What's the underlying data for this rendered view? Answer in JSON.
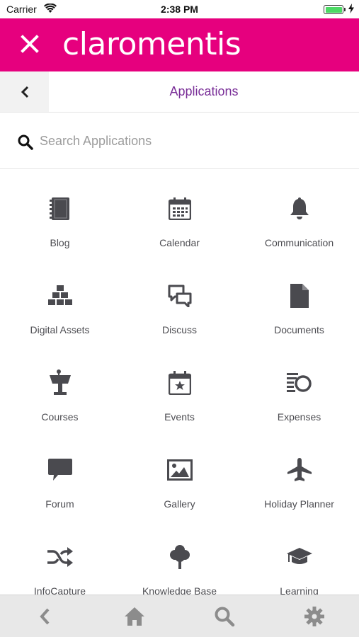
{
  "status_bar": {
    "carrier": "Carrier",
    "time": "2:38 PM",
    "battery_level": 1.0
  },
  "brand": {
    "name": "claromentis",
    "color": "#e6007e"
  },
  "header": {
    "title": "Applications",
    "title_color": "#7a2f98"
  },
  "search": {
    "placeholder": "Search Applications",
    "value": ""
  },
  "apps": [
    {
      "label": "Blog",
      "icon": "notebook-icon"
    },
    {
      "label": "Calendar",
      "icon": "calendar-icon"
    },
    {
      "label": "Communication",
      "icon": "bell-icon"
    },
    {
      "label": "Digital Assets",
      "icon": "stacked-boxes-icon"
    },
    {
      "label": "Discuss",
      "icon": "chat-bubbles-icon"
    },
    {
      "label": "Documents",
      "icon": "document-icon"
    },
    {
      "label": "Courses",
      "icon": "lectern-icon"
    },
    {
      "label": "Events",
      "icon": "calendar-star-icon"
    },
    {
      "label": "Expenses",
      "icon": "coins-icon"
    },
    {
      "label": "Forum",
      "icon": "speech-bubble-icon"
    },
    {
      "label": "Gallery",
      "icon": "image-icon"
    },
    {
      "label": "Holiday Planner",
      "icon": "plane-icon"
    },
    {
      "label": "InfoCapture",
      "icon": "shuffle-icon"
    },
    {
      "label": "Knowledge Base",
      "icon": "tree-icon"
    },
    {
      "label": "Learning",
      "icon": "graduation-cap-icon"
    }
  ],
  "bottom_tabs": [
    {
      "name": "back",
      "icon": "chevron-left-icon"
    },
    {
      "name": "home",
      "icon": "home-icon"
    },
    {
      "name": "search",
      "icon": "search-icon"
    },
    {
      "name": "settings",
      "icon": "gear-icon"
    }
  ]
}
